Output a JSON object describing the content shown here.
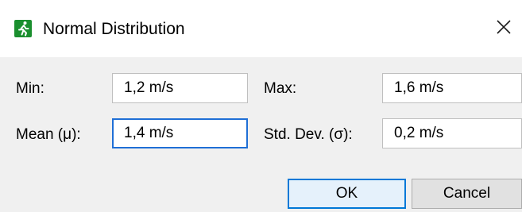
{
  "window": {
    "title": "Normal Distribution",
    "icon": "running-man-icon",
    "close_glyph": "✕"
  },
  "fields": {
    "min_label": "Min:",
    "min_value": "1,2 m/s",
    "max_label": "Max:",
    "max_value": "1,6 m/s",
    "mean_label": "Mean (μ):",
    "mean_value": "1,4 m/s",
    "stddev_label": "Std. Dev. (σ):",
    "stddev_value": "0,2 m/s"
  },
  "buttons": {
    "ok_label": "OK",
    "cancel_label": "Cancel"
  },
  "colors": {
    "icon_green": "#1a8f2e",
    "focus_blue": "#1f6fd6",
    "dialog_bg": "#f0f0f0"
  }
}
